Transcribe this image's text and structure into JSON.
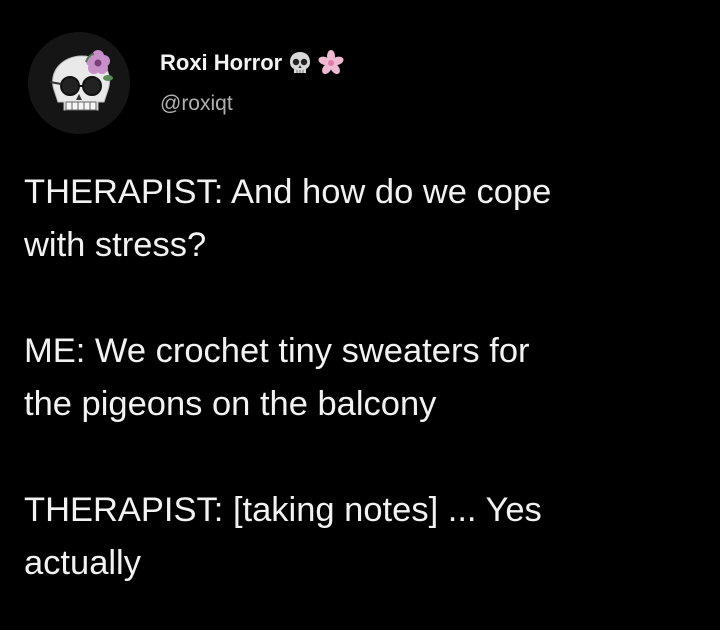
{
  "author": {
    "display_name": "Roxi Horror",
    "name_emojis": [
      "skull-emoji",
      "cherry-blossom-emoji"
    ],
    "handle": "@roxiqt",
    "avatar_icon": "skull-with-flower-avatar"
  },
  "tweet": {
    "paragraphs": [
      "THERAPIST: And how do we cope\nwith stress?",
      "ME: We crochet tiny sweaters for\nthe pigeons on the balcony",
      "THERAPIST: [taking notes] ... Yes\nactually"
    ]
  },
  "colors": {
    "background": "#000000",
    "text": "#f2f2f2",
    "handle": "#b0b0b0",
    "flower": "#c98fc9"
  }
}
